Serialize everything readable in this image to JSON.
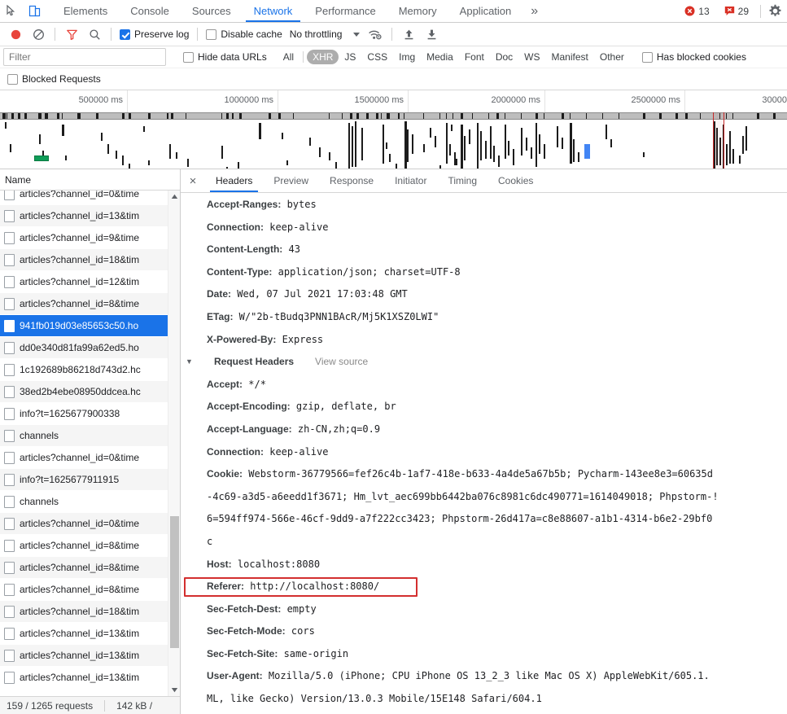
{
  "devtools": {
    "icons": {
      "inspect": "inspect-element-icon",
      "device": "device-toolbar-icon",
      "more": "»",
      "gear": "settings-gear-icon"
    },
    "tabs": [
      {
        "label": "Elements",
        "active": false
      },
      {
        "label": "Console",
        "active": false
      },
      {
        "label": "Sources",
        "active": false
      },
      {
        "label": "Network",
        "active": true
      },
      {
        "label": "Performance",
        "active": false
      },
      {
        "label": "Memory",
        "active": false
      },
      {
        "label": "Application",
        "active": false
      }
    ],
    "more_label": "»",
    "errors": {
      "count": "13",
      "icon": "error-circle-icon"
    },
    "warnings": {
      "count": "29",
      "icon": "issues-message-icon"
    }
  },
  "network_toolbar": {
    "record": {
      "name": "record-button",
      "title": "Record"
    },
    "clear": {
      "name": "clear-button",
      "title": "Clear"
    },
    "filter": {
      "name": "filter-funnel-icon",
      "title": "Filter"
    },
    "search": {
      "name": "search-icon",
      "title": "Search"
    },
    "preserve_log": {
      "label": "Preserve log",
      "checked": true
    },
    "disable_cache": {
      "label": "Disable cache",
      "checked": false
    },
    "throttling": {
      "value": "No throttling"
    },
    "network_conditions": {
      "name": "wifi-settings-icon"
    },
    "import_har": {
      "name": "upload-arrow-icon"
    },
    "export_har": {
      "name": "download-arrow-icon"
    }
  },
  "filter_bar": {
    "search_placeholder": "Filter",
    "search_value": "",
    "hide_data_urls": {
      "label": "Hide data URLs",
      "checked": false
    },
    "types": [
      {
        "label": "All",
        "selected": false
      },
      {
        "label": "XHR",
        "selected": true
      },
      {
        "label": "JS",
        "selected": false
      },
      {
        "label": "CSS",
        "selected": false
      },
      {
        "label": "Img",
        "selected": false
      },
      {
        "label": "Media",
        "selected": false
      },
      {
        "label": "Font",
        "selected": false
      },
      {
        "label": "Doc",
        "selected": false
      },
      {
        "label": "WS",
        "selected": false
      },
      {
        "label": "Manifest",
        "selected": false
      },
      {
        "label": "Other",
        "selected": false
      }
    ],
    "has_blocked_cookies": {
      "label": "Has blocked cookies",
      "checked": false
    },
    "blocked_requests": {
      "label": "Blocked Requests",
      "checked": false
    }
  },
  "overview": {
    "ticks": [
      "500000 ms",
      "1000000 ms",
      "1500000 ms",
      "2000000 ms",
      "2500000 ms",
      "30000"
    ]
  },
  "request_list": {
    "column_header": "Name",
    "rows": [
      {
        "name": "articles?channel_id=0&time",
        "selected": false
      },
      {
        "name": "articles?channel_id=13&tim",
        "selected": false
      },
      {
        "name": "articles?channel_id=9&time",
        "selected": false
      },
      {
        "name": "articles?channel_id=18&tim",
        "selected": false
      },
      {
        "name": "articles?channel_id=12&tim",
        "selected": false
      },
      {
        "name": "articles?channel_id=8&time",
        "selected": false
      },
      {
        "name": "941fb019d03e85653c50.ho",
        "selected": true
      },
      {
        "name": "dd0e340d81fa99a62ed5.ho",
        "selected": false
      },
      {
        "name": "1c192689b86218d743d2.hc",
        "selected": false
      },
      {
        "name": "38ed2b4ebe08950ddcea.hc",
        "selected": false
      },
      {
        "name": "info?t=1625677900338",
        "selected": false
      },
      {
        "name": "channels",
        "selected": false
      },
      {
        "name": "articles?channel_id=0&time",
        "selected": false
      },
      {
        "name": "info?t=1625677911915",
        "selected": false
      },
      {
        "name": "channels",
        "selected": false
      },
      {
        "name": "articles?channel_id=0&time",
        "selected": false
      },
      {
        "name": "articles?channel_id=8&time",
        "selected": false
      },
      {
        "name": "articles?channel_id=8&time",
        "selected": false
      },
      {
        "name": "articles?channel_id=8&time",
        "selected": false
      },
      {
        "name": "articles?channel_id=18&tim",
        "selected": false
      },
      {
        "name": "articles?channel_id=13&tim",
        "selected": false
      },
      {
        "name": "articles?channel_id=13&tim",
        "selected": false
      },
      {
        "name": "articles?channel_id=13&tim",
        "selected": false
      }
    ],
    "status": {
      "requests": "159 / 1265 requests",
      "transferred": "142 kB /"
    }
  },
  "detail": {
    "close_label": "×",
    "tabs": [
      {
        "label": "Headers",
        "active": true
      },
      {
        "label": "Preview",
        "active": false
      },
      {
        "label": "Response",
        "active": false
      },
      {
        "label": "Initiator",
        "active": false
      },
      {
        "label": "Timing",
        "active": false
      },
      {
        "label": "Cookies",
        "active": false
      }
    ],
    "response_headers": [
      {
        "key": "Accept-Ranges:",
        "value": "bytes"
      },
      {
        "key": "Connection:",
        "value": "keep-alive"
      },
      {
        "key": "Content-Length:",
        "value": "43"
      },
      {
        "key": "Content-Type:",
        "value": "application/json; charset=UTF-8"
      },
      {
        "key": "Date:",
        "value": "Wed, 07 Jul 2021 17:03:48 GMT"
      },
      {
        "key": "ETag:",
        "value": "W/\"2b-tBudq3PNN1BAcR/Mj5K1XSZ0LWI\""
      },
      {
        "key": "X-Powered-By:",
        "value": "Express"
      }
    ],
    "request_headers_section": {
      "triangle": "▼",
      "title": "Request Headers",
      "view_source": "View source"
    },
    "request_headers": [
      {
        "key": "Accept:",
        "value": "*/*",
        "highlight": false
      },
      {
        "key": "Accept-Encoding:",
        "value": "gzip, deflate, br",
        "highlight": false
      },
      {
        "key": "Accept-Language:",
        "value": "zh-CN,zh;q=0.9",
        "highlight": false
      },
      {
        "key": "Connection:",
        "value": "keep-alive",
        "highlight": false
      }
    ],
    "cookie_header": {
      "key": "Cookie:",
      "lines": [
        "Webstorm-36779566=fef26c4b-1af7-418e-b633-4a4de5a67b5b; Pycharm-143ee8e3=60635d",
        "-4c69-a3d5-a6eedd1f3671; Hm_lvt_aec699bb6442ba076c8981c6dc490771=1614049018; Phpstorm-!",
        "6=594ff974-566e-46cf-9dd9-a7f222cc3423; Phpstorm-26d417a=c8e88607-a1b1-4314-b6e2-29bf0",
        "c"
      ]
    },
    "request_headers_tail": [
      {
        "key": "Host:",
        "value": "localhost:8080",
        "highlight": false
      },
      {
        "key": "Referer:",
        "value": "http://localhost:8080/",
        "highlight": true
      },
      {
        "key": "Sec-Fetch-Dest:",
        "value": "empty",
        "highlight": false
      },
      {
        "key": "Sec-Fetch-Mode:",
        "value": "cors",
        "highlight": false
      },
      {
        "key": "Sec-Fetch-Site:",
        "value": "same-origin",
        "highlight": false
      }
    ],
    "user_agent": {
      "key": "User-Agent:",
      "lines": [
        "Mozilla/5.0 (iPhone; CPU iPhone OS 13_2_3 like Mac OS X) AppleWebKit/605.1.",
        "ML, like Gecko) Version/13.0.3 Mobile/15E148 Safari/604.1"
      ]
    }
  },
  "colors": {
    "accent": "#1a73e8",
    "error_red": "#d93025",
    "highlight_red": "#d32f2f",
    "selected_row": "#1a73e8"
  }
}
